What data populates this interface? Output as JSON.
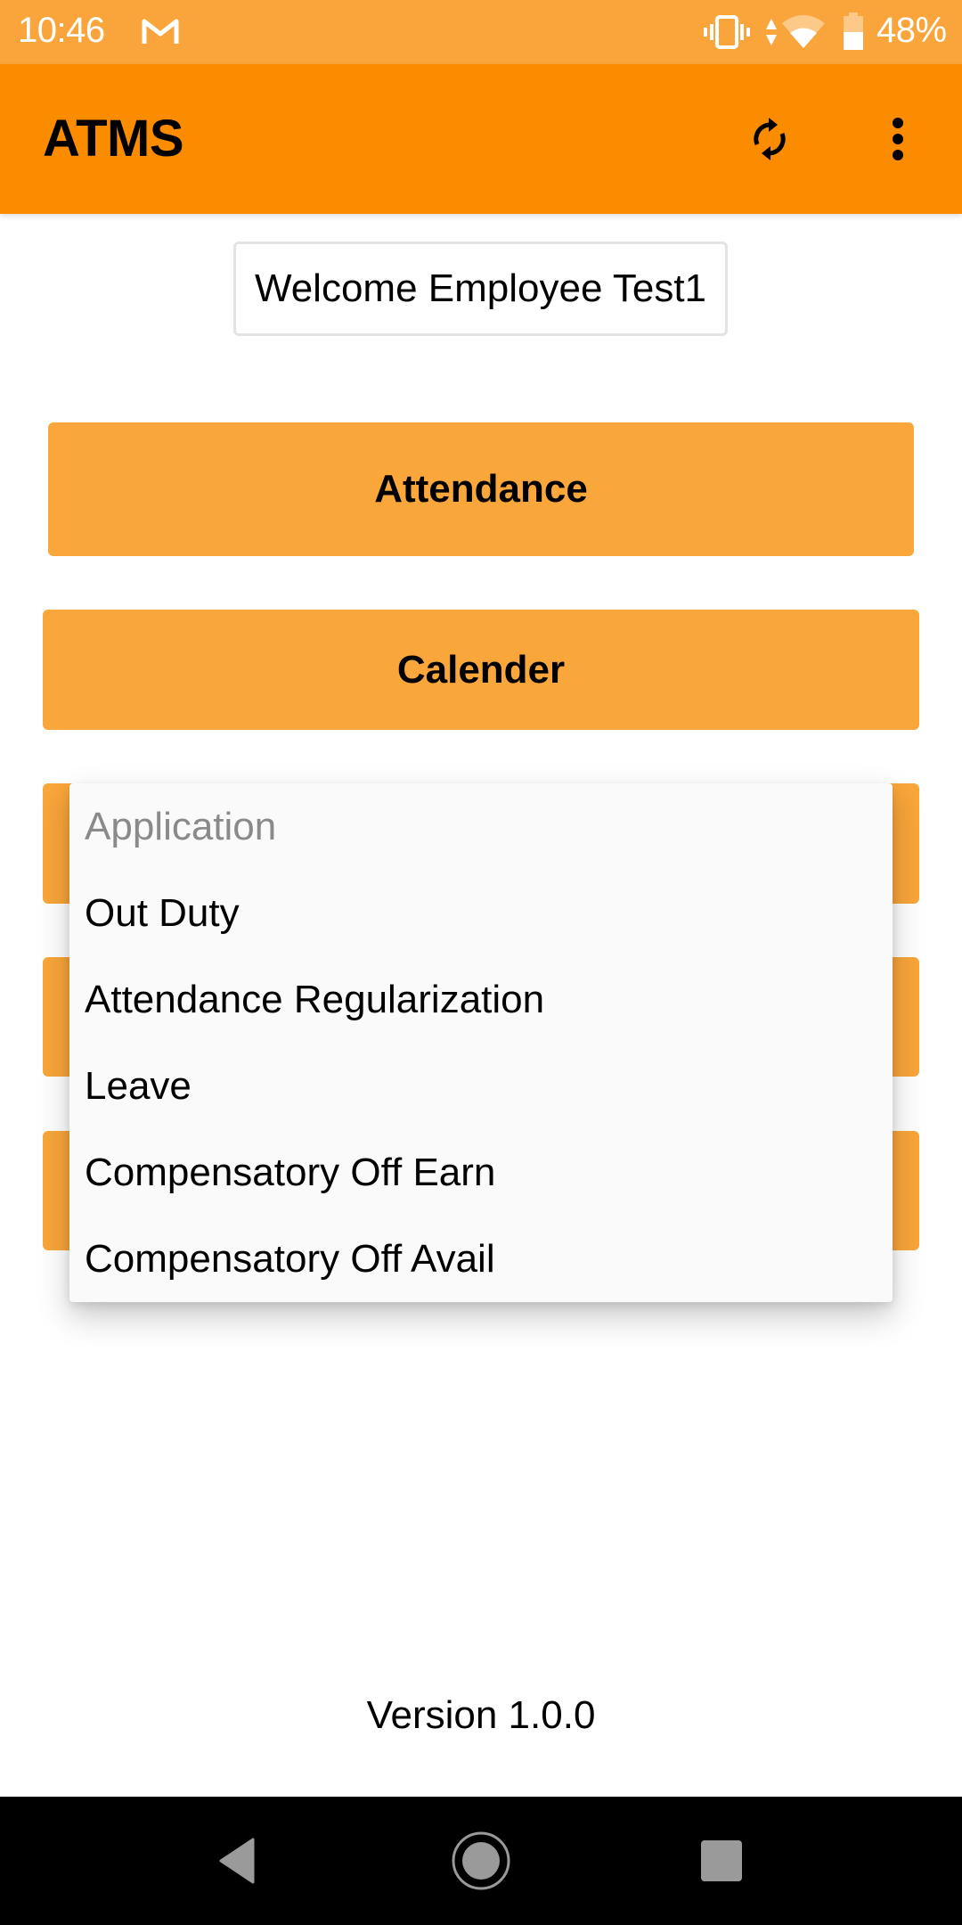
{
  "status_bar": {
    "time": "10:46",
    "battery_percent": "48%",
    "icons": [
      "gmail-icon",
      "vibrate-icon",
      "data-arrows-icon",
      "wifi-icon",
      "battery-icon"
    ]
  },
  "app_bar": {
    "title": "ATMS",
    "actions": [
      "refresh-icon",
      "more-vert-icon"
    ]
  },
  "welcome": {
    "text": "Welcome Employee Test1"
  },
  "buttons": [
    {
      "label": "Attendance"
    },
    {
      "label": "Calender"
    },
    {
      "label": ""
    },
    {
      "label": ""
    },
    {
      "label": ""
    }
  ],
  "dropdown": {
    "header": "Application",
    "items": [
      {
        "label": "Out Duty"
      },
      {
        "label": "Attendance Regularization"
      },
      {
        "label": "Leave"
      },
      {
        "label": "Compensatory Off Earn"
      },
      {
        "label": "Compensatory Off Avail"
      }
    ]
  },
  "footer": {
    "version": "Version 1.0.0"
  },
  "nav_bar": {
    "buttons": [
      "back-icon",
      "home-icon",
      "recents-icon"
    ]
  },
  "colors": {
    "status_bar": "#faa53b",
    "app_bar": "#fb8c00",
    "button": "#f9a63a",
    "popup_bg": "#fafafa",
    "header_text": "#8a8a8a"
  }
}
